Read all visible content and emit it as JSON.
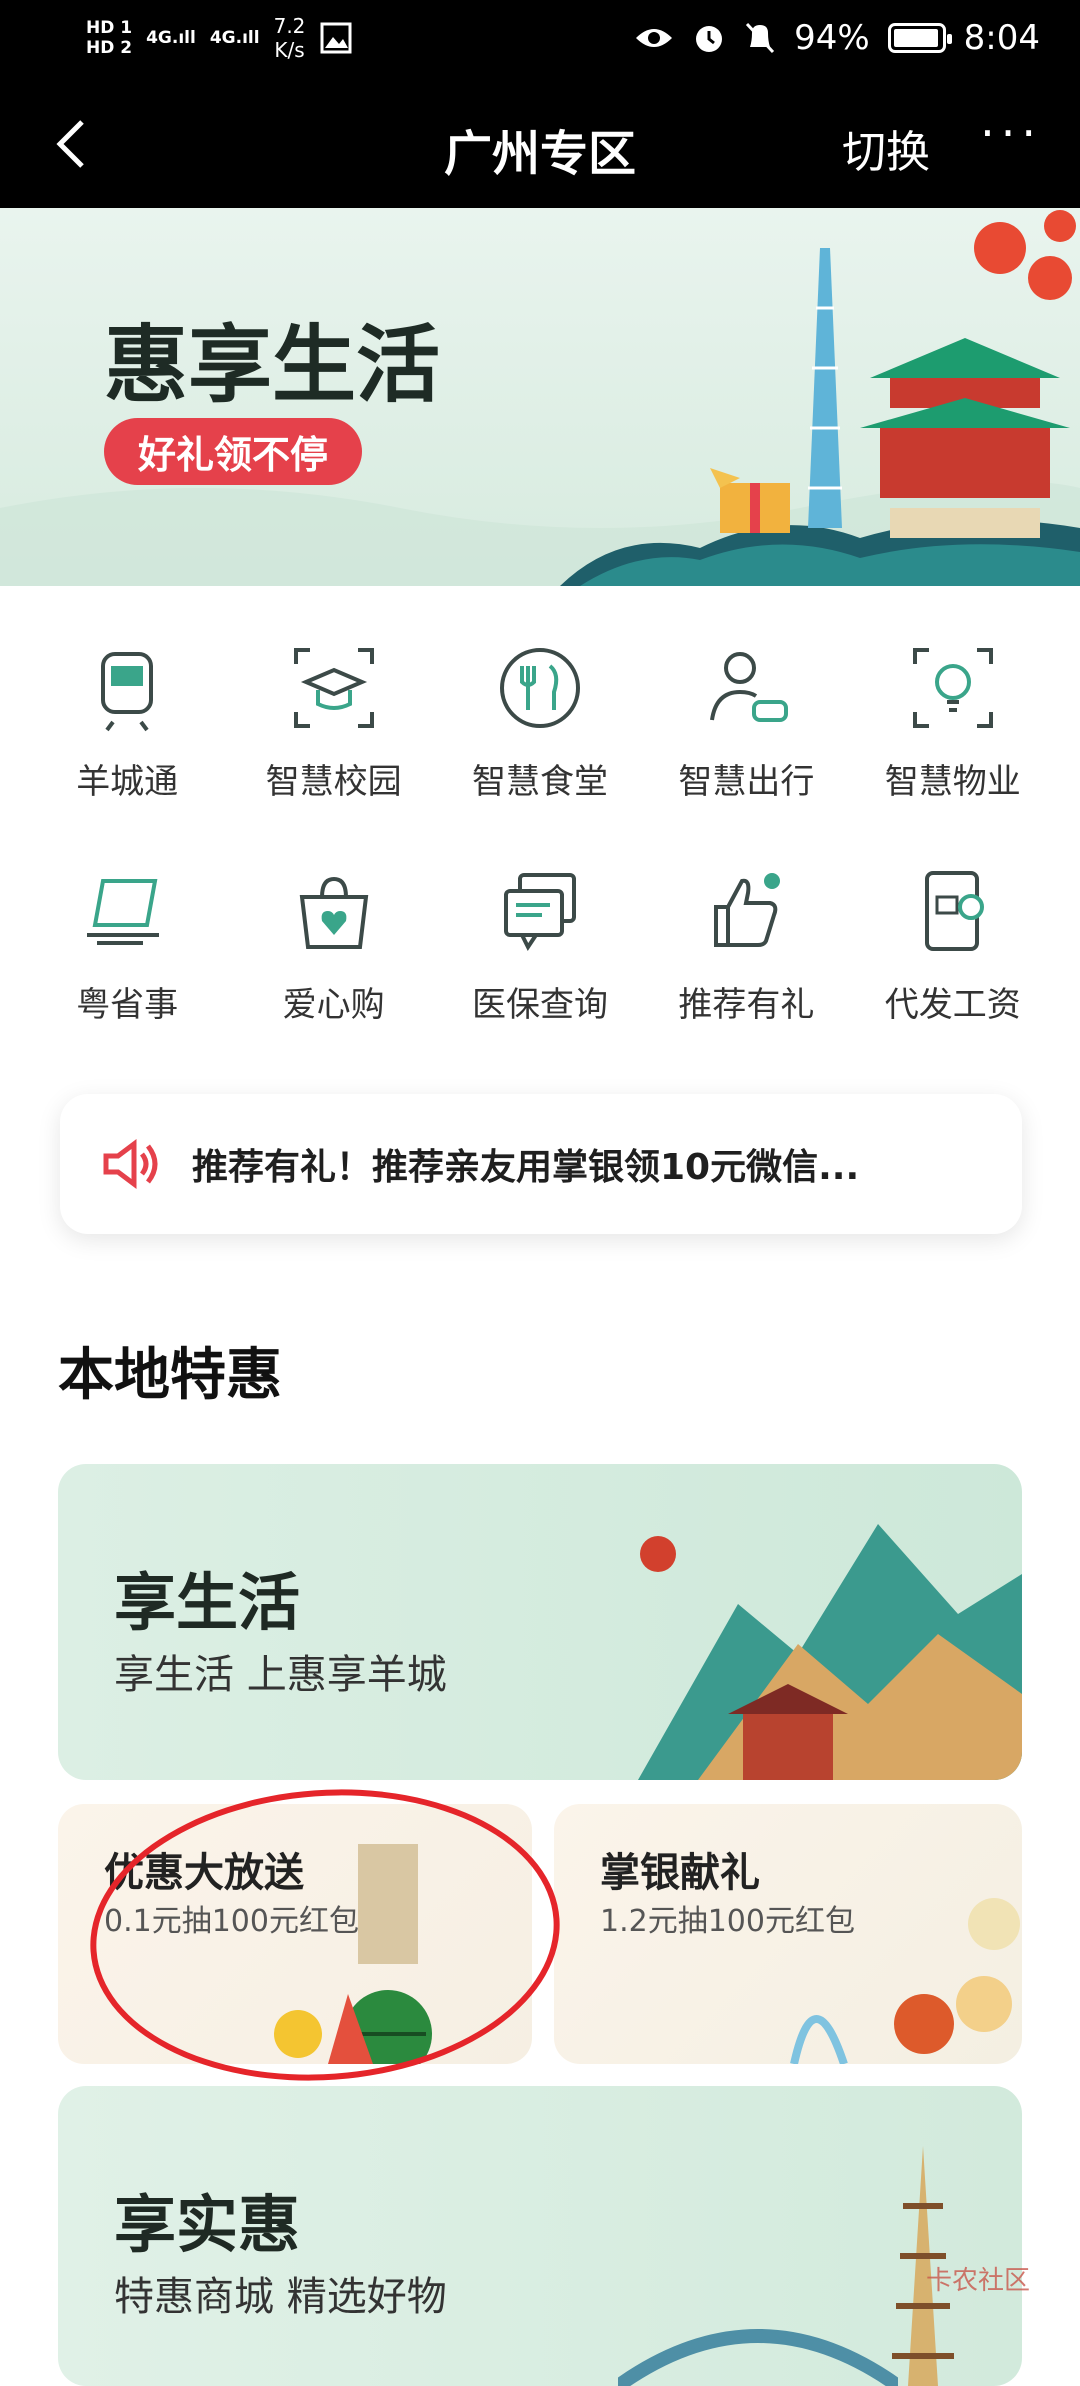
{
  "status_bar": {
    "hd1": "HD 1",
    "hd2": "HD 2",
    "sig1": "4G",
    "sig2": "4G",
    "speed": "7.2",
    "speed_unit": "K/s",
    "battery": "94%",
    "time": "8:04"
  },
  "nav": {
    "title": "广州专区",
    "switch": "切换",
    "more": "···"
  },
  "banner": {
    "title": "惠享生活",
    "tag": "好礼领不停"
  },
  "services_row1": [
    {
      "label": "羊城通",
      "icon": "metro-card-icon"
    },
    {
      "label": "智慧校园",
      "icon": "graduation-cap-icon"
    },
    {
      "label": "智慧食堂",
      "icon": "fork-knife-icon"
    },
    {
      "label": "智慧出行",
      "icon": "person-car-icon"
    },
    {
      "label": "智慧物业",
      "icon": "lightbulb-icon"
    }
  ],
  "services_row2": [
    {
      "label": "粤省事",
      "icon": "laptop-icon"
    },
    {
      "label": "爱心购",
      "icon": "heart-bag-icon"
    },
    {
      "label": "医保查询",
      "icon": "document-chat-icon"
    },
    {
      "label": "推荐有礼",
      "icon": "thumbs-up-icon"
    },
    {
      "label": "代发工资",
      "icon": "salary-card-icon"
    }
  ],
  "notice": {
    "text": "推荐有礼！推荐亲友用掌银领10元微信..."
  },
  "section": {
    "title": "本地特惠"
  },
  "cards": {
    "life": {
      "title": "享生活",
      "subtitle": "享生活 上惠享羊城"
    },
    "promo": {
      "title": "优惠大放送",
      "subtitle": "0.1元抽100元红包"
    },
    "gift": {
      "title": "掌银献礼",
      "subtitle": "1.2元抽100元红包"
    },
    "shop": {
      "title": "享实惠",
      "subtitle": "特惠商城 精选好物"
    }
  },
  "watermark": "卡农社区",
  "colors": {
    "accent_red": "#e5414b",
    "teal": "#3aa58a"
  }
}
